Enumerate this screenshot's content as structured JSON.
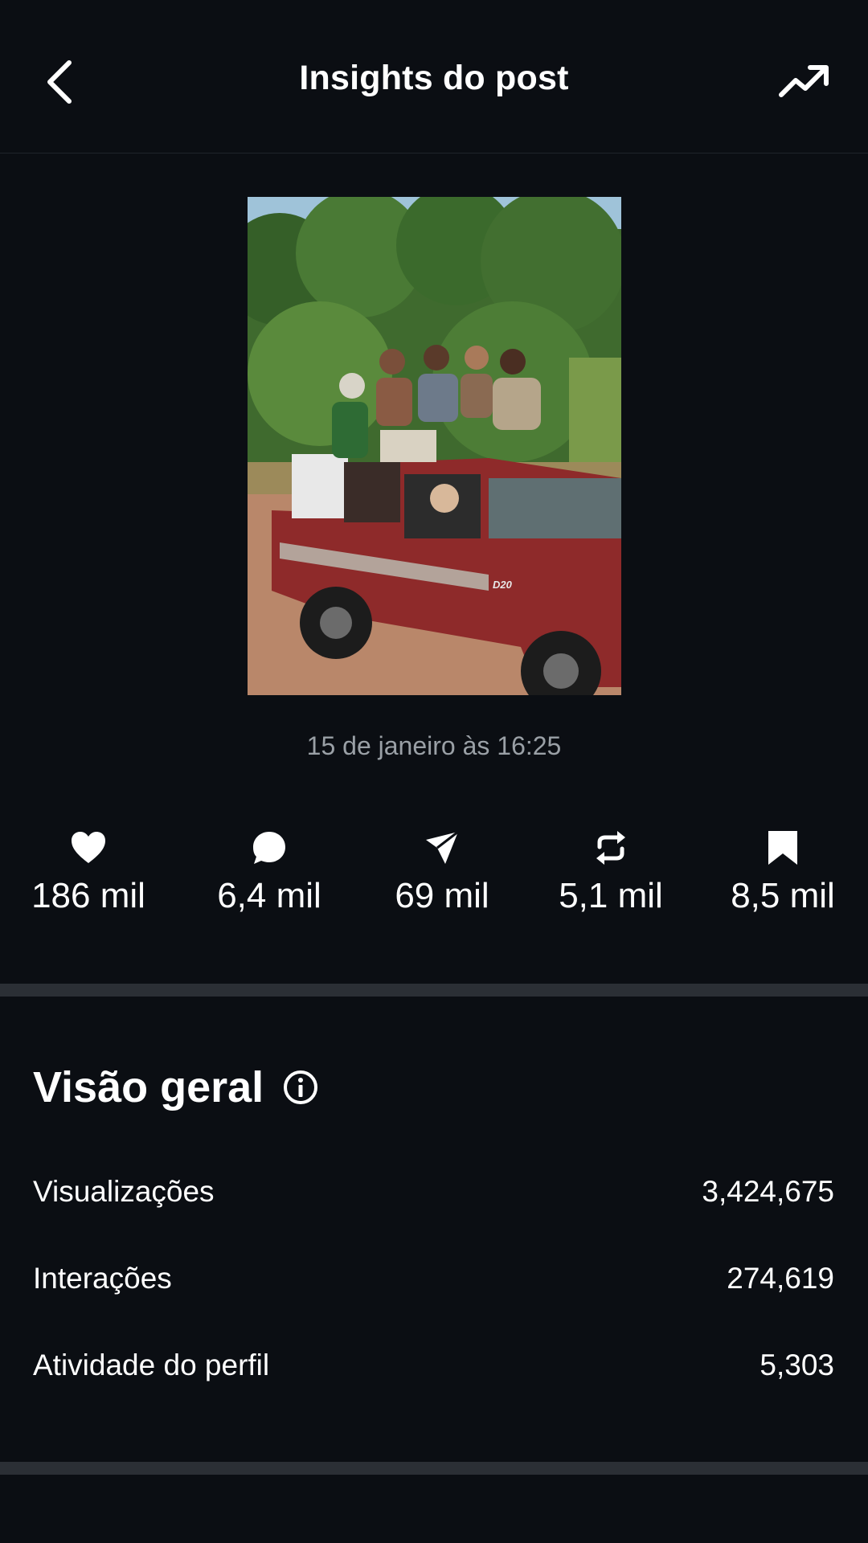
{
  "header": {
    "title": "Insights do post",
    "back_icon": "chevron-left-icon",
    "trend_icon": "trending-up-icon"
  },
  "post": {
    "date": "15 de janeiro às 16:25",
    "truck_badge": "D20"
  },
  "stats": [
    {
      "icon": "heart-icon",
      "value": "186 mil"
    },
    {
      "icon": "comment-icon",
      "value": "6,4 mil"
    },
    {
      "icon": "share-icon",
      "value": "69 mil"
    },
    {
      "icon": "repost-icon",
      "value": "5,1 mil"
    },
    {
      "icon": "bookmark-icon",
      "value": "8,5 mil"
    }
  ],
  "overview": {
    "title": "Visão geral",
    "rows": [
      {
        "label": "Visualizações",
        "value": "3,424,675"
      },
      {
        "label": "Interações",
        "value": "274,619"
      },
      {
        "label": "Atividade do perfil",
        "value": "5,303"
      }
    ]
  },
  "colors": {
    "background": "#0b0e13",
    "divider": "#2b2f35",
    "muted_text": "#9aa0a6"
  }
}
